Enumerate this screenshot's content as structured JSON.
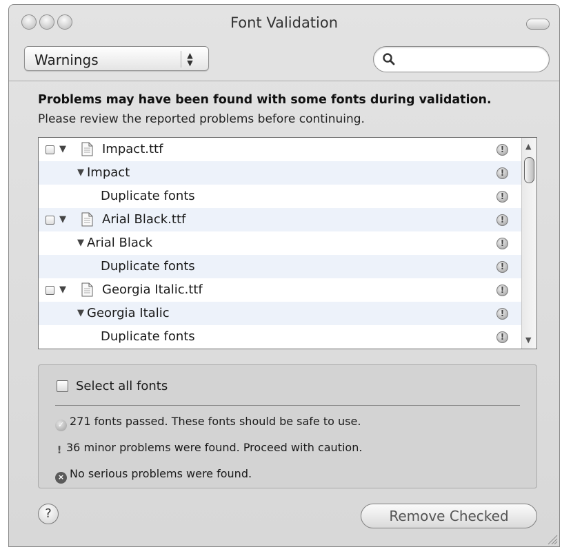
{
  "window": {
    "title": "Font Validation"
  },
  "filter": {
    "selected": "Warnings"
  },
  "search": {
    "value": "",
    "placeholder": ""
  },
  "message": {
    "heading": "Problems may have been found with some fonts during validation.",
    "subtext": "Please review the reported problems before continuing."
  },
  "tree": {
    "rows": [
      {
        "level": 0,
        "label": "Impact.ttf",
        "status": "warning"
      },
      {
        "level": 1,
        "label": "Impact",
        "status": "warning"
      },
      {
        "level": 2,
        "label": "Duplicate fonts",
        "status": "warning"
      },
      {
        "level": 0,
        "label": "Arial Black.ttf",
        "status": "warning"
      },
      {
        "level": 1,
        "label": "Arial Black",
        "status": "warning"
      },
      {
        "level": 2,
        "label": "Duplicate fonts",
        "status": "warning"
      },
      {
        "level": 0,
        "label": "Georgia Italic.ttf",
        "status": "warning"
      },
      {
        "level": 1,
        "label": "Georgia Italic",
        "status": "warning"
      },
      {
        "level": 2,
        "label": "Duplicate fonts",
        "status": "warning"
      }
    ]
  },
  "summary": {
    "select_all_label": "Select all fonts",
    "passed": "271 fonts passed. These fonts should be safe to use.",
    "minor": "36 minor problems were found. Proceed with caution.",
    "serious": "No serious problems were found."
  },
  "buttons": {
    "help_glyph": "?",
    "remove_checked": "Remove Checked"
  },
  "icons": {
    "warning_glyph": "!",
    "serious_glyph": "×",
    "pass_glyph": "✓",
    "disclosure_glyph": "▼",
    "popup_arrows_glyph": "▲▼"
  }
}
